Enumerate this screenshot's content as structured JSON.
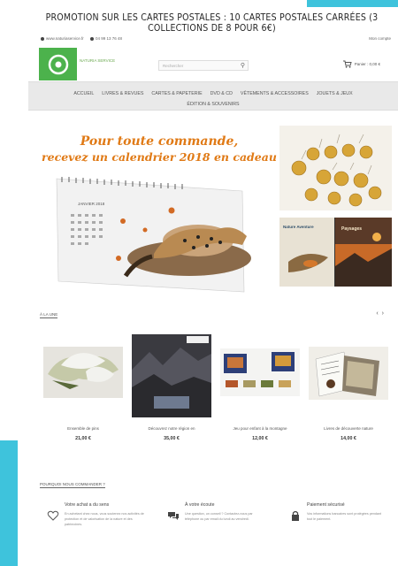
{
  "promo": "PROMOTION SUR LES CARTES POSTALES : 10 CARTES POSTALES CARRÉES (3 COLLECTIONS DE 8 POUR 6€)",
  "topbar": {
    "email": "www.naturiaservice.fr",
    "phone": "04 99 13 76 48",
    "account": "Mon compte"
  },
  "header": {
    "logo_text": "NATURIA SERVICE",
    "search_placeholder": "Rechercher",
    "cart_label": "Panier : 0,00 €"
  },
  "nav": {
    "row1": [
      "ACCUEIL",
      "LIVRES & REVUES",
      "CARTES & PAPETERIE",
      "DVD & CD",
      "VÊTEMENTS & ACCESSOIRES",
      "JOUETS & JEUX"
    ],
    "row2": [
      "ÉDITION & SOUVENIRS"
    ]
  },
  "hero": {
    "line1": "Pour toute commande,",
    "line2": "recevez un calendrier 2018 en cadeau",
    "calendar_month": "JANVIER 2018"
  },
  "side2": {
    "title1": "Nature Aventure",
    "title2": "Paysages"
  },
  "section": {
    "title": "À LA UNE"
  },
  "products": [
    {
      "name": "Ensemble de pins",
      "price": "21,00 €"
    },
    {
      "name": "Découvrez notre région en",
      "price": "35,00 €"
    },
    {
      "name": "Jeu pour enfant à la montagne",
      "price": "12,00 €"
    },
    {
      "name": "Livres de découverte nature",
      "price": "14,00 €"
    }
  ],
  "footer": {
    "title": "POURQUOI NOUS COMMANDER ?",
    "features": [
      {
        "title": "Votre achat a du sens",
        "desc": "En achetant chez nous, vous soutenez nos activités de protection et de valorisation de la nature et des patrimoines."
      },
      {
        "title": "À votre écoute",
        "desc": "Une question, un conseil ? Contactez-nous par téléphone ou par email du lundi au vendredi."
      },
      {
        "title": "Paiement sécurisé",
        "desc": "Vos informations bancaires sont protégées pendant tout le paiement."
      }
    ]
  },
  "colors": {
    "accent": "#3ec3dc",
    "brand_green": "#4cb24c",
    "hero_orange": "#e07a16"
  },
  "icons": [
    "spiral-logo-icon",
    "search-icon",
    "cart-icon",
    "heart-icon",
    "chat-icon",
    "lock-icon",
    "arrow-left-icon",
    "arrow-right-icon"
  ]
}
